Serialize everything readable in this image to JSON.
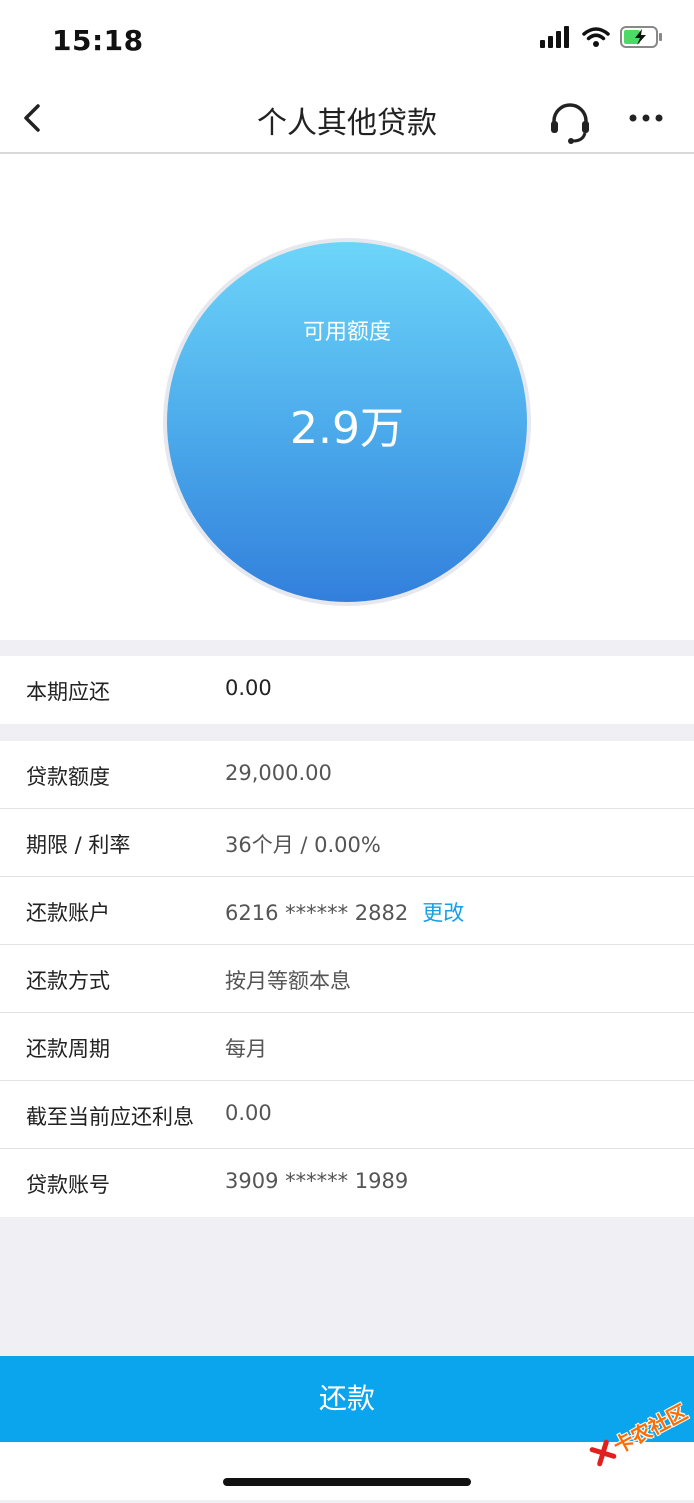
{
  "status_bar": {
    "time": "15:18",
    "icons": [
      "cellular-signal-icon",
      "wifi-icon",
      "battery-charging-icon"
    ],
    "battery_color": "#4cd964"
  },
  "nav": {
    "title": "个人其他贷款",
    "icons": [
      "chevron-left-icon",
      "headset-icon",
      "more-icon"
    ]
  },
  "hero": {
    "label": "可用额度",
    "value": "2.9万"
  },
  "section1": {
    "rows": [
      {
        "label": "本期应还",
        "value": "0.00"
      }
    ]
  },
  "section2": {
    "rows": [
      {
        "label": "贷款额度",
        "value": "29,000.00"
      },
      {
        "label": "期限 / 利率",
        "value": "36个月 / 0.00%"
      },
      {
        "label": "还款账户",
        "value": "6216 ****** 2882",
        "action": "更改"
      },
      {
        "label": "还款方式",
        "value": "按月等额本息"
      },
      {
        "label": "还款周期",
        "value": "每月"
      },
      {
        "label": "截至当前应还利息",
        "value": "0.00"
      },
      {
        "label": "贷款账号",
        "value": "3909 ****** 1989"
      }
    ]
  },
  "footer": {
    "repay_label": "还款"
  },
  "watermark": {
    "text": "卡农社区"
  },
  "colors": {
    "accent": "#0aa5ec",
    "link": "#14a0e6",
    "circle_top": "#6dd5f9",
    "circle_bottom": "#327fdc"
  }
}
